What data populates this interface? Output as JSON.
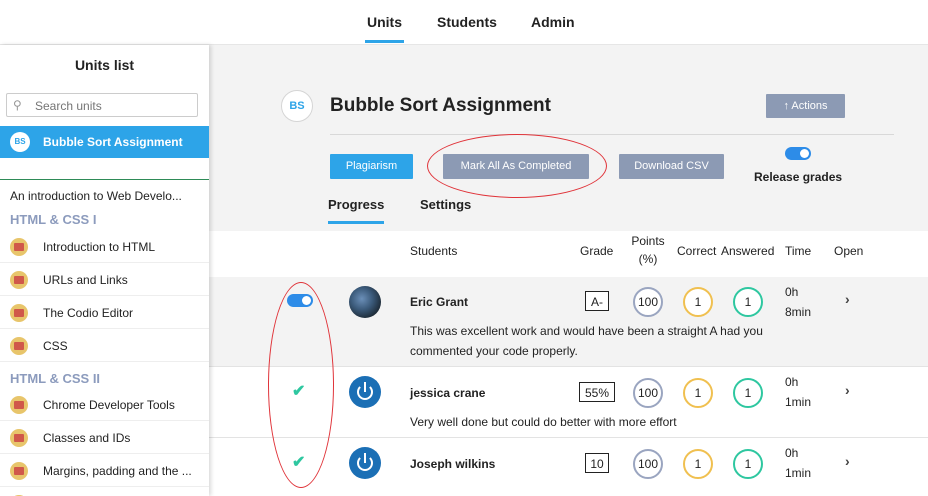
{
  "topnav": {
    "tabs": [
      "Units",
      "Students",
      "Admin"
    ]
  },
  "sidebar": {
    "title": "Units list",
    "search_placeholder": "Search units",
    "current": {
      "badge": "BS",
      "label": "Bubble Sort Assignment"
    },
    "course": "An introduction to Web Develo...",
    "sections": [
      {
        "title": "HTML & CSS I",
        "items": [
          "Introduction to HTML",
          "URLs and Links",
          "The Codio Editor",
          "CSS"
        ]
      },
      {
        "title": "HTML & CSS II",
        "items": [
          "Chrome Developer Tools",
          "Classes and IDs",
          "Margins, padding and the ..."
        ]
      }
    ]
  },
  "assignment": {
    "badge": "BS",
    "title": "Bubble Sort Assignment",
    "actions_label": "↑ Actions",
    "buttons": {
      "plagiarism": "Plagiarism",
      "mark_all": "Mark All As Completed",
      "download_csv": "Download CSV"
    },
    "release_grades": "Release grades",
    "subtabs": [
      "Progress",
      "Settings"
    ]
  },
  "table": {
    "headers": {
      "students": "Students",
      "grade": "Grade",
      "points_line1": "Points",
      "points_line2": "(%)",
      "correct": "Correct",
      "answered": "Answered",
      "time": "Time",
      "open": "Open"
    },
    "rows": [
      {
        "name": "Eric Grant",
        "grade": "A-",
        "points": "100",
        "correct": "1",
        "answered": "1",
        "time_h": "0h",
        "time_m": "8min",
        "comment_line1": "This was excellent work and would have been a straight A had you",
        "comment_line2": "commented your code properly."
      },
      {
        "name": "jessica crane",
        "grade": "55%",
        "points": "100",
        "correct": "1",
        "answered": "1",
        "time_h": "0h",
        "time_m": "1min",
        "comment_line1": "Very well done but could do better with more effort"
      },
      {
        "name": "Joseph wilkins",
        "grade": "10",
        "points": "100",
        "correct": "1",
        "answered": "1",
        "time_h": "0h",
        "time_m": "1min"
      }
    ]
  },
  "icons": {
    "search": "search-icon",
    "check": "check-icon",
    "chevron": "chevron-right-icon",
    "toggle": "toggle-switch"
  },
  "colors": {
    "accent": "#2da4e8",
    "secondary": "#8c9ab4",
    "annotation": "#e0343a",
    "check": "#2ec7a0"
  }
}
